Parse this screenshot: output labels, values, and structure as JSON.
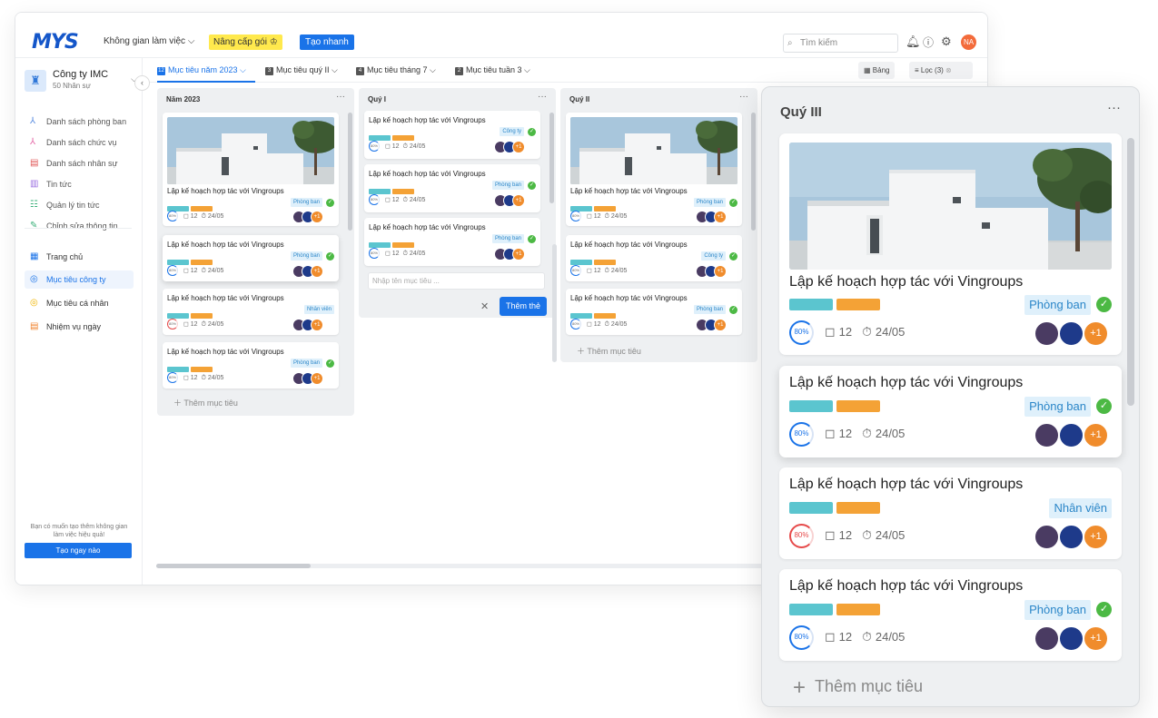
{
  "brand": {
    "logo": "MYS"
  },
  "topbar": {
    "workspace": "Không gian làm việc ⌵",
    "upgrade": "Nâng cấp gói",
    "quick_create": "Tạo nhanh",
    "search_placeholder": "Tìm kiếm",
    "user_initials": "NA"
  },
  "sidebar": {
    "company_name": "Công ty IMC",
    "company_members": "50 Nhân sự",
    "items": [
      {
        "label": "Danh sách phòng ban"
      },
      {
        "label": "Danh sách chức vụ"
      },
      {
        "label": "Danh sách nhân sự"
      },
      {
        "label": "Tin tức"
      },
      {
        "label": "Quản lý tin tức"
      },
      {
        "label": "Chỉnh sửa thông tin"
      },
      {
        "label": "Trang chủ"
      },
      {
        "label": "Mục tiêu công ty"
      },
      {
        "label": "Mục tiêu cá nhân"
      },
      {
        "label": "Nhiệm vụ ngày"
      }
    ],
    "promo_text": "Bạn có muốn tạo thêm không gian làm việc hiệu quả!",
    "promo_button": "Tạo ngay nào"
  },
  "tabs": [
    {
      "num": "12",
      "label": "Mục tiêu năm 2023 ⌵"
    },
    {
      "num": "3",
      "label": "Mục tiêu quý II ⌵"
    },
    {
      "num": "4",
      "label": "Mục tiêu tháng 7 ⌵"
    },
    {
      "num": "2",
      "label": "Mục tiêu tuần 3 ⌵"
    }
  ],
  "views": {
    "table": "Bảng",
    "filter": "Lọc (3)"
  },
  "card_common": {
    "title": "Lập kế hoạch hợp tác với Vingroups",
    "progress": "80%",
    "comments": "12",
    "due": "24/05",
    "extra_assignees": "+1"
  },
  "columns": [
    {
      "title": "Năm 2023",
      "badges": [
        "Phòng ban",
        "Phòng ban",
        "Nhân viên",
        "Phòng ban"
      ]
    },
    {
      "title": "Quý I",
      "badges": [
        "Công ty",
        "Phòng ban",
        "Phòng ban"
      ]
    },
    {
      "title": "Quý II",
      "badges": [
        "Phòng ban",
        "Công ty",
        "Phòng ban"
      ]
    }
  ],
  "add_goal": "Thêm mục tiêu",
  "new_goal_placeholder": "Nhập tên mục tiêu ...",
  "add_card_button": "Thêm thẻ",
  "zoom": {
    "title": "Quý III",
    "badges": [
      "Phòng ban",
      "Phòng ban",
      "Nhân viên",
      "Phòng ban"
    ]
  },
  "colors": {
    "accent": "#1a73e8",
    "bar_teal": "#5bc5cf",
    "bar_orange": "#f4a236",
    "verified": "#4cb944"
  },
  "icons": [
    "search-icon",
    "bell-icon",
    "help-icon",
    "gear-icon",
    "comment-icon",
    "timer-icon",
    "check-badge-icon"
  ]
}
